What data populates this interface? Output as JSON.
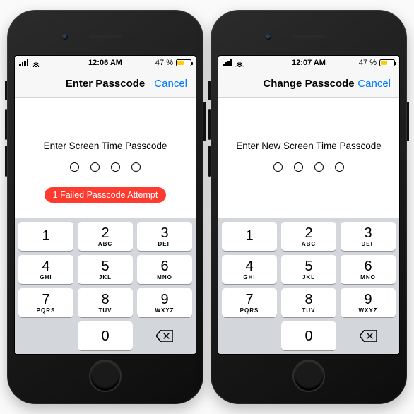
{
  "phones": [
    {
      "status": {
        "time": "12:06 AM",
        "battery": "47 %"
      },
      "nav": {
        "title": "Enter Passcode",
        "cancel": "Cancel"
      },
      "content": {
        "prompt": "Enter Screen Time Passcode",
        "error": "1 Failed Passcode Attempt",
        "show_error": true
      }
    },
    {
      "status": {
        "time": "12:07 AM",
        "battery": "47 %"
      },
      "nav": {
        "title": "Change Passcode",
        "cancel": "Cancel"
      },
      "content": {
        "prompt": "Enter New Screen Time Passcode",
        "error": "",
        "show_error": false
      }
    }
  ],
  "keypad": {
    "keys": [
      {
        "num": "1",
        "letters": " "
      },
      {
        "num": "2",
        "letters": "ABC"
      },
      {
        "num": "3",
        "letters": "DEF"
      },
      {
        "num": "4",
        "letters": "GHI"
      },
      {
        "num": "5",
        "letters": "JKL"
      },
      {
        "num": "6",
        "letters": "MNO"
      },
      {
        "num": "7",
        "letters": "PQRS"
      },
      {
        "num": "8",
        "letters": "TUV"
      },
      {
        "num": "9",
        "letters": "WXYZ"
      },
      {
        "num": "0",
        "letters": ""
      }
    ]
  }
}
